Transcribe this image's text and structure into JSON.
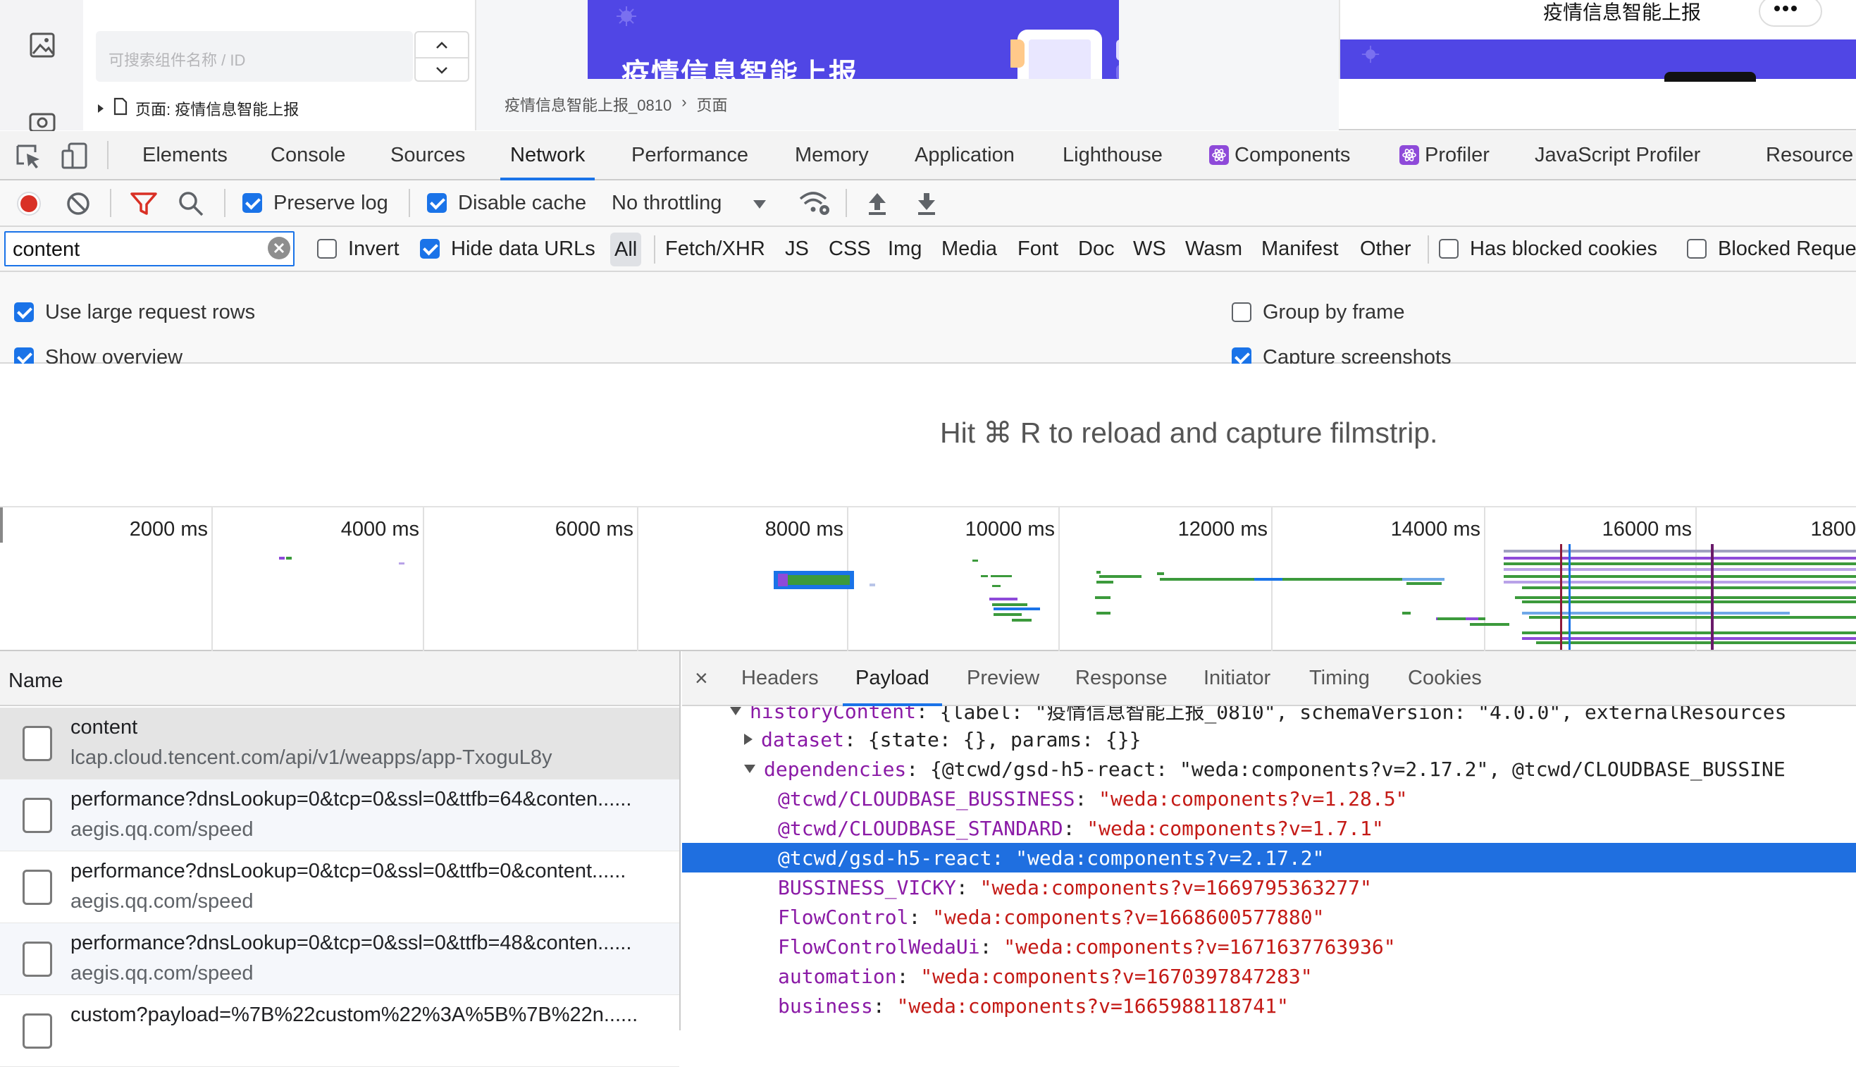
{
  "app": {
    "search_placeholder": "可搜索组件名称 / ID",
    "tree_row_label": "页面: 疫情信息智能上报",
    "breadcrumb": [
      "疫情信息智能上报_0810",
      "页面"
    ],
    "banner_title": "疫情信息智能上报",
    "preview_title": "疫情信息智能上报",
    "brand_color": "#5046e5"
  },
  "devtools": {
    "tabs": [
      "Elements",
      "Console",
      "Sources",
      "Network",
      "Performance",
      "Memory",
      "Application",
      "Lighthouse",
      "Components",
      "Profiler",
      "JavaScript Profiler",
      "Resource"
    ],
    "active_tab": "Network"
  },
  "toolbar": {
    "preserve_log": "Preserve log",
    "disable_cache": "Disable cache",
    "throttling": "No throttling"
  },
  "filter": {
    "value": "content",
    "invert": "Invert",
    "hide_data_urls": "Hide data URLs",
    "types": [
      "All",
      "Fetch/XHR",
      "JS",
      "CSS",
      "Img",
      "Media",
      "Font",
      "Doc",
      "WS",
      "Wasm",
      "Manifest",
      "Other"
    ],
    "has_blocked_cookies": "Has blocked cookies",
    "blocked_requests": "Blocked Reque"
  },
  "settings": {
    "use_large_rows": "Use large request rows",
    "show_overview": "Show overview",
    "group_by_frame": "Group by frame",
    "capture_screenshots": "Capture screenshots"
  },
  "filmstrip": {
    "message": "Hit ⌘ R to reload and capture filmstrip."
  },
  "overview": {
    "ticks": [
      "2000 ms",
      "4000 ms",
      "6000 ms",
      "8000 ms",
      "10000 ms",
      "12000 ms",
      "14000 ms",
      "16000 ms",
      "1800"
    ]
  },
  "requests": {
    "header": "Name",
    "rows": [
      {
        "name": "content",
        "domain": "lcap.cloud.tencent.com/api/v1/weapps/app-TxoguL8y"
      },
      {
        "name": "performance?dnsLookup=0&tcp=0&ssl=0&ttfb=64&conten......",
        "domain": "aegis.qq.com/speed"
      },
      {
        "name": "performance?dnsLookup=0&tcp=0&ssl=0&ttfb=0&content......",
        "domain": "aegis.qq.com/speed"
      },
      {
        "name": "performance?dnsLookup=0&tcp=0&ssl=0&ttfb=48&conten......",
        "domain": "aegis.qq.com/speed"
      },
      {
        "name": "custom?payload=%7B%22custom%22%3A%5B%7B%22n......",
        "domain": ""
      }
    ]
  },
  "detail": {
    "close": "×",
    "tabs": [
      "Headers",
      "Payload",
      "Preview",
      "Response",
      "Initiator",
      "Timing",
      "Cookies"
    ],
    "active_tab": "Payload",
    "lines": [
      {
        "key": "historyContent",
        "text": "{label: \"疫情信息智能上报_0810\", schemaVersion: \"4.0.0\", externalResources"
      },
      {
        "key": "dataset",
        "text": "{state: {}, params: {}}"
      },
      {
        "key": "dependencies",
        "text": "{@tcwd/gsd-h5-react: \"weda:components?v=2.17.2\", @tcwd/CLOUDBASE_BUSSINE"
      },
      {
        "key": "@tcwd/CLOUDBASE_BUSSINESS",
        "text": "\"weda:components?v=1.28.5\""
      },
      {
        "key": "@tcwd/CLOUDBASE_STANDARD",
        "text": "\"weda:components?v=1.7.1\""
      },
      {
        "key": "@tcwd/gsd-h5-react",
        "text": "\"weda:components?v=2.17.2\""
      },
      {
        "key": "BUSSINESS_VICKY",
        "text": "\"weda:components?v=1669795363277\""
      },
      {
        "key": "FlowControl",
        "text": "\"weda:components?v=1668600577880\""
      },
      {
        "key": "FlowControlWedaUi",
        "text": "\"weda:components?v=1671637763936\""
      },
      {
        "key": "automation",
        "text": "\"weda:components?v=1670397847283\""
      },
      {
        "key": "business",
        "text": "\"weda:components?v=1665988118741\""
      }
    ]
  }
}
